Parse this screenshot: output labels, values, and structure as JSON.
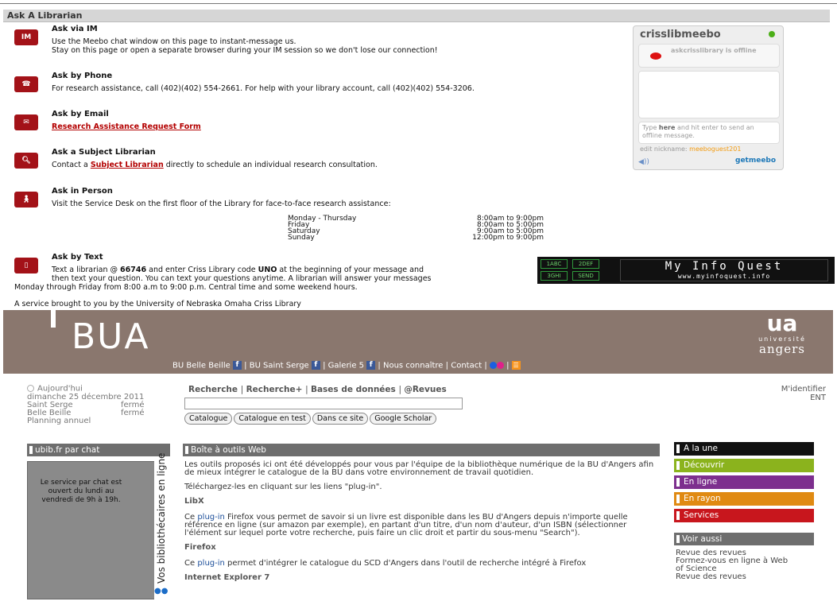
{
  "ask": {
    "header": "Ask A Librarian",
    "im": {
      "icon": "IM",
      "title": "Ask via IM",
      "line1": "Use the Meebo chat window on this page to instant-message us.",
      "line2": "Stay on this page or open a separate browser during your IM session so we don't lose our connection!"
    },
    "phone": {
      "title": "Ask by Phone",
      "text": "For research assistance, call (402)(402) 554-2661. For help with your library account, call (402)(402) 554-3206."
    },
    "email": {
      "title": "Ask by Email",
      "link": "Research Assistance Request Form"
    },
    "subject": {
      "title": "Ask a Subject Librarian",
      "pre": "Contact a ",
      "link": "Subject Librarian",
      "post": " directly to schedule an individual research consultation."
    },
    "person": {
      "title": "Ask in Person",
      "text": "Visit the Service Desk on the first floor of the Library for face-to-face research assistance:"
    },
    "hours": [
      {
        "day": "Monday - Thursday",
        "time": "8:00am to 9:00pm"
      },
      {
        "day": "Friday",
        "time": "8:00am to 5:00pm"
      },
      {
        "day": "Saturday",
        "time": "9:00am to 5:00pm"
      },
      {
        "day": "Sunday",
        "time": "12:00pm to 9:00pm"
      }
    ],
    "text": {
      "title": "Ask by Text",
      "l1a": "Text a librarian @ ",
      "l1b": "66746",
      "l1c": " and enter Criss Library code ",
      "l1d": "UNO",
      "l1e": " at the beginning of your message and",
      "line2": "then text your question. You can text your questions anytime. A librarian will answer your messages",
      "line3": "Monday through Friday from 8:00 a.m to 9:00 p.m. Central time and some weekend hours."
    },
    "footer": "A service brought to you by the University of Nebraska Omaha Criss Library"
  },
  "meebo": {
    "title": "crisslibmeebo",
    "status": "askcrisslibrary is offline",
    "placeholder_a": "Type ",
    "placeholder_b": "here",
    "placeholder_c": " and hit enter to send an offline message.",
    "nick_label": "edit nickname: ",
    "nick": "meeboguest201",
    "get": "getmeebo",
    "speaker": "◀))"
  },
  "miq": {
    "k1": "1ABC",
    "k2": "2DEF",
    "k3": "3GHI",
    "k4": "SEND",
    "title": "My Info Quest",
    "url": "www.myinfoquest.info"
  },
  "bua": {
    "logo": "BUA",
    "univ_mark": "ua",
    "univ_small": "université",
    "univ_name": "angers",
    "nav": [
      "BU Belle Beille",
      "BU Saint Serge",
      "Galerie 5",
      "Nous connaître",
      "Contact"
    ],
    "fb": "f",
    "sep": "|",
    "rss": "☰",
    "today": "Aujourd'hui",
    "date": "dimanche 25 décembre 2011",
    "status": [
      {
        "site": "Saint Serge",
        "state": "fermé"
      },
      {
        "site": "Belle Beille",
        "state": "fermé"
      }
    ],
    "planning": "Planning annuel",
    "search_tabs": [
      "Recherche",
      "Recherche+",
      "Bases de données",
      "@Revues"
    ],
    "buttons": [
      "Catalogue",
      "Catalogue en test",
      "Dans ce site",
      "Google Scholar"
    ],
    "login": "M'identifier",
    "ent": "ENT",
    "chat_head": "ubib.fr par chat",
    "chat_text": "Le service par chat est ouvert du lundi au vendredi de 9h à 19h.",
    "chat_vertical": "Vos bibliothécaires en ligne",
    "main_head": "Boîte à outils Web",
    "p1": "Les outils proposés ici ont été développés pour vous par l'équipe de la bibliothèque numérique de la BU d'Angers afin de mieux intégrer le catalogue de la BU dans votre environnement de travail quotidien.",
    "p2": "Téléchargez-les en cliquant sur les liens \"plug-in\".",
    "h_libx": "LibX",
    "p3a": "Ce ",
    "plugin": "plug-in",
    "p3b": " Firefox vous permet de savoir si un livre est disponible dans les BU d'Angers depuis n'importe quelle référence en ligne (sur amazon par exemple), en partant d'un titre, d'un nom d'auteur, d'un ISBN (sélectionner l'élément sur lequel porte votre recherche, puis faire un clic droit et partir du sous-menu \"Search\").",
    "h_ff": "Firefox",
    "p4a": "Ce ",
    "p4b": " permet d'intégrer le catalogue du SCD d'Angers dans l'outil de recherche intégré à Firefox",
    "h_ie": "Internet Explorer 7",
    "rnav": [
      {
        "label": "A la une",
        "color": "#111111"
      },
      {
        "label": "Découvrir",
        "color": "#8bb31d"
      },
      {
        "label": "En ligne",
        "color": "#7d2f8e"
      },
      {
        "label": "En rayon",
        "color": "#e08a12"
      },
      {
        "label": "Services",
        "color": "#c8161d"
      }
    ],
    "voir": "Voir aussi",
    "links": [
      "Revue des revues",
      "Formez-vous en ligne à Web",
      "of Science",
      "Revue des revues"
    ]
  },
  "colors": {
    "accent_red": "#a31218",
    "bua_brown": "#8a776e",
    "panel_gray": "#6e6e6e"
  }
}
